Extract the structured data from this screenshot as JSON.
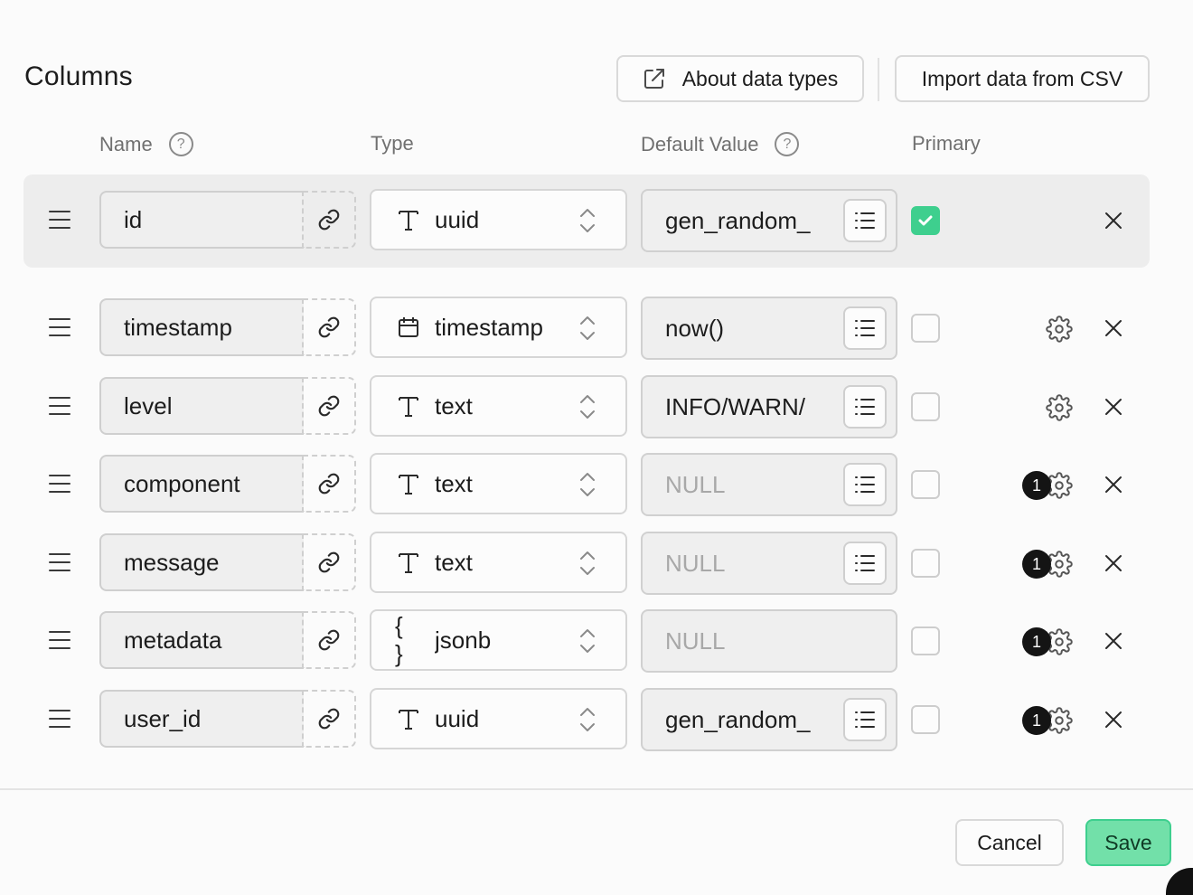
{
  "header": {
    "title": "Columns",
    "about_label": "About data types",
    "import_label": "Import data from CSV"
  },
  "column_headers": {
    "name": "Name",
    "type": "Type",
    "default_value": "Default Value",
    "primary": "Primary"
  },
  "rows": [
    {
      "name": "id",
      "type": "uuid",
      "type_icon": "text-type-icon",
      "default": "gen_random_",
      "default_is_null": false,
      "has_list_button": true,
      "primary": true,
      "badge": "",
      "has_gear": false
    },
    {
      "name": "timestamp",
      "type": "timestamp",
      "type_icon": "calendar-icon",
      "default": "now()",
      "default_is_null": false,
      "has_list_button": true,
      "primary": false,
      "badge": "",
      "has_gear": true
    },
    {
      "name": "level",
      "type": "text",
      "type_icon": "text-type-icon",
      "default": "INFO/WARN/",
      "default_is_null": false,
      "has_list_button": true,
      "primary": false,
      "badge": "",
      "has_gear": true
    },
    {
      "name": "component",
      "type": "text",
      "type_icon": "text-type-icon",
      "default": "NULL",
      "default_is_null": true,
      "has_list_button": true,
      "primary": false,
      "badge": "1",
      "has_gear": true
    },
    {
      "name": "message",
      "type": "text",
      "type_icon": "text-type-icon",
      "default": "NULL",
      "default_is_null": true,
      "has_list_button": true,
      "primary": false,
      "badge": "1",
      "has_gear": true
    },
    {
      "name": "metadata",
      "type": "jsonb",
      "type_icon": "json-braces-icon",
      "default": "NULL",
      "default_is_null": true,
      "has_list_button": false,
      "primary": false,
      "badge": "1",
      "has_gear": true
    },
    {
      "name": "user_id",
      "type": "uuid",
      "type_icon": "text-type-icon",
      "default": "gen_random_",
      "default_is_null": false,
      "has_list_button": true,
      "primary": false,
      "badge": "1",
      "has_gear": true
    }
  ],
  "footer": {
    "cancel_label": "Cancel",
    "save_label": "Save"
  },
  "colors": {
    "accent": "#3ecf8e",
    "save_bg": "#72e0a9",
    "primary_row_bg": "#ededed"
  }
}
